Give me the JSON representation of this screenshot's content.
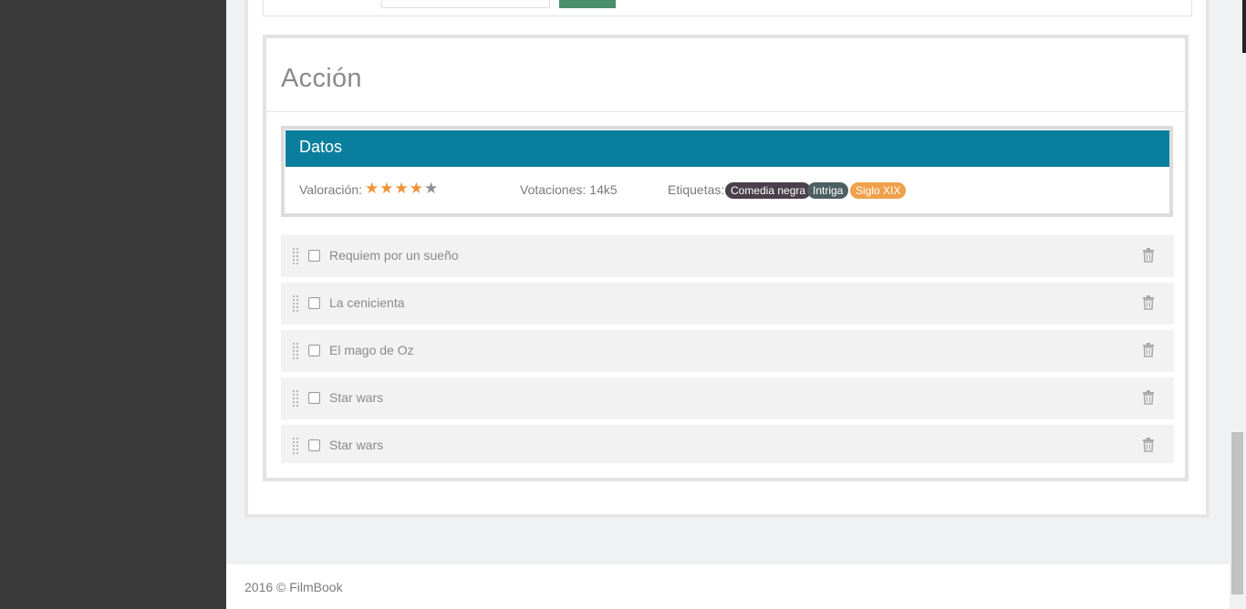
{
  "section": {
    "title": "Acción"
  },
  "datos": {
    "title": "Datos",
    "valoracion_label": "Valoración:",
    "rating": 4,
    "rating_max": 5,
    "votaciones_label": "Votaciones:",
    "votaciones_value": "14k5",
    "etiquetas_label": "Etiquetas:",
    "tags": [
      {
        "label": "Comedia negra",
        "color": "#4a3f4b"
      },
      {
        "label": "Intriga",
        "color": "#4e5f63"
      },
      {
        "label": "Siglo XIX",
        "color": "#f0a04b"
      }
    ]
  },
  "items": [
    {
      "label": "Requiem por un sueño"
    },
    {
      "label": "La cenicienta"
    },
    {
      "label": "El mago de Oz"
    },
    {
      "label": "Star wars"
    },
    {
      "label": "Star wars"
    }
  ],
  "footer": {
    "text": "2016 © FilmBook"
  },
  "colors": {
    "sidebar": "#3a3a3a",
    "header_accent": "#0a7f9d",
    "star_on": "#f0923a",
    "star_off": "#8f8f8f",
    "top_button": "#4a8f6c"
  },
  "icons": {
    "star": "star-icon",
    "drag": "drag-handle-icon",
    "delete": "trash-icon"
  }
}
